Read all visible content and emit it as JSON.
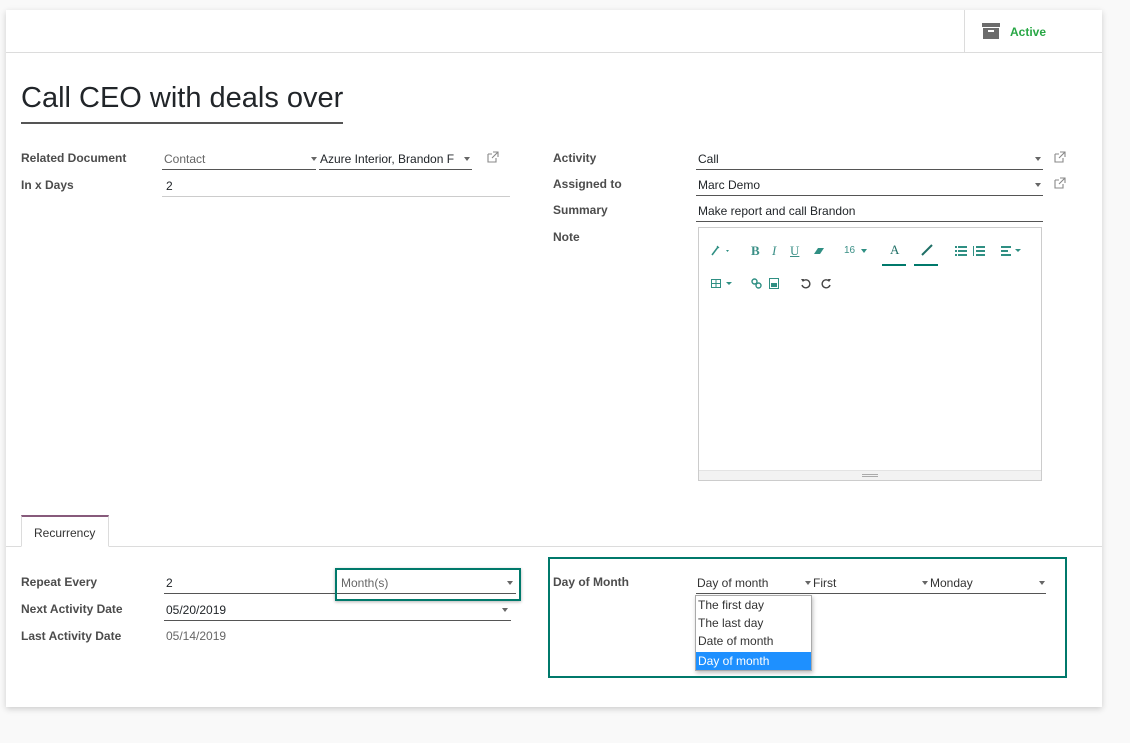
{
  "header": {
    "status_label": "Active"
  },
  "record": {
    "title": "Call CEO with deals over"
  },
  "left": {
    "related_document_label": "Related Document",
    "related_model": "Contact",
    "related_record": "Azure Interior, Brandon F",
    "in_x_days_label": "In x Days",
    "in_x_days_value": "2"
  },
  "right": {
    "activity_label": "Activity",
    "activity_value": "Call",
    "assigned_to_label": "Assigned to",
    "assigned_to_value": "Marc Demo",
    "summary_label": "Summary",
    "summary_value": "Make report and call Brandon",
    "note_label": "Note"
  },
  "editor_toolbar": {
    "font_size": "16",
    "bold": "B",
    "italic": "I",
    "underline": "U",
    "font_color": "A"
  },
  "tabs": [
    {
      "label": "Recurrency"
    }
  ],
  "recurrency": {
    "repeat_every_label": "Repeat Every",
    "repeat_every_value": "2",
    "repeat_unit": "Month(s)",
    "next_activity_label": "Next Activity Date",
    "next_activity_value": "05/20/2019",
    "last_activity_label": "Last Activity Date",
    "last_activity_value": "05/14/2019",
    "day_of_month_label": "Day of Month",
    "day_of_month_mode": "Day of month",
    "ordinal": "First",
    "weekday": "Monday",
    "mode_options": [
      "The first day",
      "The last day",
      "Date of month",
      "Day of month"
    ],
    "selected_option_index": 3
  },
  "colors": {
    "accent": "#00796b",
    "active_green": "#28a745",
    "tab_top": "#875a7b",
    "selection": "#1e90ff"
  }
}
